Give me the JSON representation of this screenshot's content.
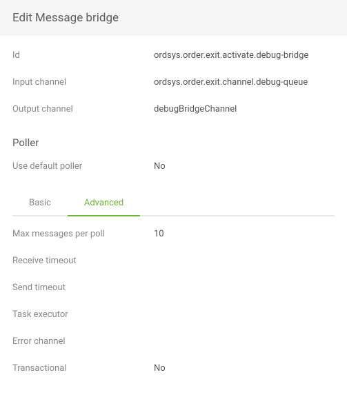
{
  "header": {
    "title": "Edit Message bridge"
  },
  "fields": {
    "id": {
      "label": "Id",
      "value": "ordsys.order.exit.activate.debug-bridge"
    },
    "inputChannel": {
      "label": "Input channel",
      "value": "ordsys.order.exit.channel.debug-queue"
    },
    "outputChannel": {
      "label": "Output channel",
      "value": "debugBridgeChannel"
    }
  },
  "poller": {
    "title": "Poller",
    "useDefault": {
      "label": "Use default poller",
      "value": "No"
    },
    "tabs": {
      "basic": "Basic",
      "advanced": "Advanced"
    },
    "activeTab": "advanced",
    "advanced": {
      "maxMessages": {
        "label": "Max messages per poll",
        "value": "10"
      },
      "receiveTimeout": {
        "label": "Receive timeout",
        "value": ""
      },
      "sendTimeout": {
        "label": "Send timeout",
        "value": ""
      },
      "taskExecutor": {
        "label": "Task executor",
        "value": ""
      },
      "errorChannel": {
        "label": "Error channel",
        "value": ""
      },
      "transactional": {
        "label": "Transactional",
        "value": "No"
      }
    }
  }
}
